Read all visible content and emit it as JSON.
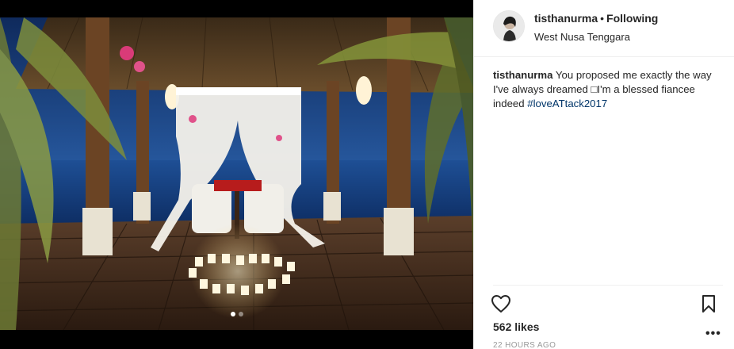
{
  "post": {
    "username": "tisthanurma",
    "separator": "•",
    "follow_status": "Following",
    "location": "West Nusa Tenggara",
    "caption": {
      "username": "tisthanurma",
      "text": " You proposed me exactly the way I've always dreamed □I'm a blessed fiancee indeed ",
      "hashtag": "#loveATtack2017"
    },
    "likes": "562 likes",
    "time": "22 HOURS AGO",
    "more": "•••"
  },
  "carousel": {
    "count": 2,
    "active_index": 0
  },
  "icons": {
    "like": "heart-outline-icon",
    "save": "bookmark-icon",
    "more": "ellipsis-icon"
  },
  "colors": {
    "hashtag": "#003569",
    "meta_text": "#999999",
    "primary_text": "#262626"
  }
}
